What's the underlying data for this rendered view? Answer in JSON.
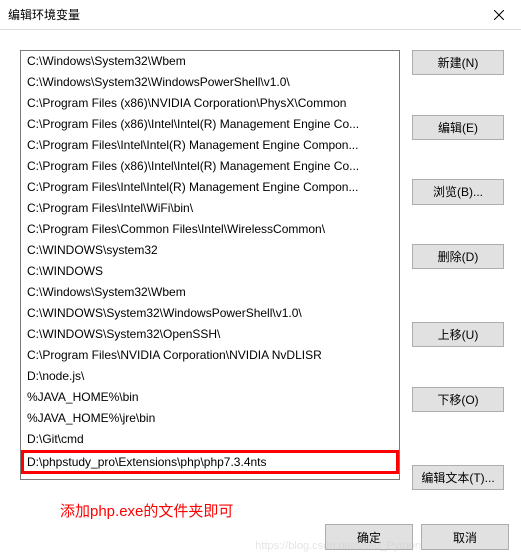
{
  "dialog": {
    "title": "编辑环境变量",
    "close_icon": "close"
  },
  "list": {
    "items": [
      "C:\\Windows\\System32\\Wbem",
      "C:\\Windows\\System32\\WindowsPowerShell\\v1.0\\",
      "C:\\Program Files (x86)\\NVIDIA Corporation\\PhysX\\Common",
      "C:\\Program Files (x86)\\Intel\\Intel(R) Management Engine Co...",
      "C:\\Program Files\\Intel\\Intel(R) Management Engine Compon...",
      "C:\\Program Files (x86)\\Intel\\Intel(R) Management Engine Co...",
      "C:\\Program Files\\Intel\\Intel(R) Management Engine Compon...",
      "C:\\Program Files\\Intel\\WiFi\\bin\\",
      "C:\\Program Files\\Common Files\\Intel\\WirelessCommon\\",
      "C:\\WINDOWS\\system32",
      "C:\\WINDOWS",
      "C:\\Windows\\System32\\Wbem",
      "C:\\WINDOWS\\System32\\WindowsPowerShell\\v1.0\\",
      "C:\\WINDOWS\\System32\\OpenSSH\\",
      "C:\\Program Files\\NVIDIA Corporation\\NVIDIA NvDLISR",
      "D:\\node.js\\",
      "%JAVA_HOME%\\bin",
      "%JAVA_HOME%\\jre\\bin",
      "D:\\Git\\cmd",
      "D:\\phpstudy_pro\\Extensions\\php\\php7.3.4nts"
    ],
    "highlighted_index": 19
  },
  "buttons": {
    "new": "新建(N)",
    "edit": "编辑(E)",
    "browse": "浏览(B)...",
    "delete": "删除(D)",
    "move_up": "上移(U)",
    "move_down": "下移(O)",
    "edit_text": "编辑文本(T)...",
    "ok": "确定",
    "cancel": "取消"
  },
  "annotation": "添加php.exe的文件夹即可",
  "watermark": "https://blog.csdn.net/used_Python"
}
